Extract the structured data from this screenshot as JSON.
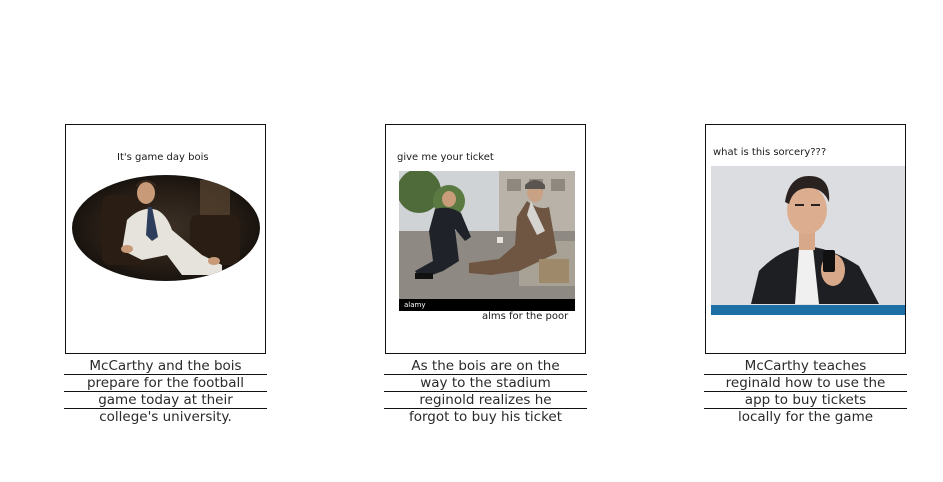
{
  "panels": [
    {
      "top_text": "It's game day bois",
      "bottom_text": "",
      "image_desc": "man in white suit sitting in chair",
      "caption_lines": [
        "McCarthy and the bois",
        "prepare for the football",
        "game today at their",
        "college's university."
      ]
    },
    {
      "top_text": "give me your ticket",
      "bottom_text": "alms for the poor",
      "watermark": "alamy",
      "image_desc": "man in suit crouching beside homeless man on sidewalk",
      "caption_lines": [
        "As the bois are on the",
        "way to the stadium",
        "reginold realizes he",
        "forgot to buy his ticket"
      ]
    },
    {
      "top_text": "what is this sorcery???",
      "bottom_text": "",
      "image_desc": "young man looking confused at smartphone",
      "caption_lines": [
        "McCarthy teaches",
        "reginald how to use the",
        "app to buy tickets",
        "locally for the game"
      ]
    }
  ],
  "colors": {
    "border": "#111111",
    "stock_banner": "#1d6fa5"
  }
}
